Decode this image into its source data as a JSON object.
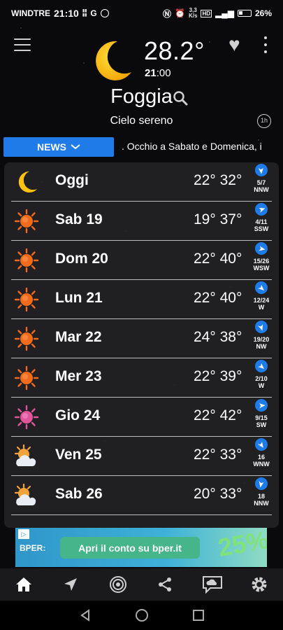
{
  "status_bar": {
    "carrier": "WINDTRE",
    "time": "21:10",
    "network_speed": "3,3",
    "network_unit": "K/s",
    "battery": "26%"
  },
  "header": {
    "temperature": "28.2°",
    "time_hour": "21",
    "time_min": ":00",
    "city": "Foggia",
    "condition": "Cielo sereno",
    "hourly_label": "1h"
  },
  "news": {
    "button_label": "NEWS",
    "ticker": ". Occhio a Sabato e Domenica, i"
  },
  "forecast": [
    {
      "day": "Oggi",
      "min": "22°",
      "max": "32°",
      "wind_speed": "5/7",
      "wind_dir": "NNW",
      "icon": "moon",
      "arrow_rotation": 135
    },
    {
      "day": "Sab 19",
      "min": "19°",
      "max": "37°",
      "wind_speed": "4/11",
      "wind_dir": "SSW",
      "icon": "sun",
      "arrow_rotation": 30
    },
    {
      "day": "Dom 20",
      "min": "22°",
      "max": "40°",
      "wind_speed": "15/26",
      "wind_dir": "WSW",
      "icon": "sun",
      "arrow_rotation": 60
    },
    {
      "day": "Lun 21",
      "min": "22°",
      "max": "40°",
      "wind_speed": "12/24",
      "wind_dir": "W",
      "icon": "sun",
      "arrow_rotation": 90
    },
    {
      "day": "Mar 22",
      "min": "24°",
      "max": "38°",
      "wind_speed": "19/20",
      "wind_dir": "NW",
      "icon": "sun",
      "arrow_rotation": 120
    },
    {
      "day": "Mer 23",
      "min": "22°",
      "max": "39°",
      "wind_speed": "2/10",
      "wind_dir": "W",
      "icon": "sun",
      "arrow_rotation": 90
    },
    {
      "day": "Gio 24",
      "min": "22°",
      "max": "42°",
      "wind_speed": "9/15",
      "wind_dir": "SW",
      "icon": "sun-hot",
      "arrow_rotation": 45
    },
    {
      "day": "Ven 25",
      "min": "22°",
      "max": "33°",
      "wind_speed": "16",
      "wind_dir": "WNW",
      "icon": "sun-cloud",
      "arrow_rotation": 105
    },
    {
      "day": "Sab 26",
      "min": "20°",
      "max": "33°",
      "wind_speed": "18",
      "wind_dir": "NNW",
      "icon": "sun-cloud",
      "arrow_rotation": 150
    }
  ],
  "ad": {
    "brand": "BPER:",
    "cta": "Apri il conto su bper.it",
    "badge": "25%"
  },
  "bottom_nav": [
    {
      "icon": "home-icon"
    },
    {
      "icon": "navigation-icon"
    },
    {
      "icon": "radar-icon"
    },
    {
      "icon": "share-icon"
    },
    {
      "icon": "chat-cloud-icon"
    },
    {
      "icon": "settings-icon"
    }
  ],
  "colors": {
    "accent_blue": "#1e7be8",
    "sun_orange": "#f26a1b",
    "moon_yellow": "#ffc20e"
  }
}
